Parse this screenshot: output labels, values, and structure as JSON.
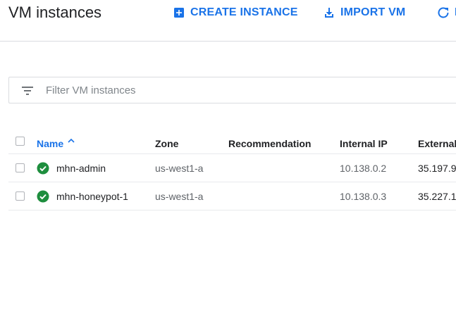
{
  "header": {
    "title": "VM instances",
    "actions": {
      "create_label": "CREATE INSTANCE",
      "import_label": "IMPORT VM",
      "refresh_label": "R"
    }
  },
  "filter": {
    "placeholder": "Filter VM instances",
    "value": ""
  },
  "table": {
    "columns": {
      "name": "Name",
      "zone": "Zone",
      "recommendation": "Recommendation",
      "internal_ip": "Internal IP",
      "external_ip": "External"
    },
    "rows": [
      {
        "name": "mhn-admin",
        "zone": "us-west1-a",
        "recommendation": "",
        "internal_ip": "10.138.0.2",
        "external_ip": "35.197.9",
        "status": "running"
      },
      {
        "name": "mhn-honeypot-1",
        "zone": "us-west1-a",
        "recommendation": "",
        "internal_ip": "10.138.0.3",
        "external_ip": "35.227.1",
        "status": "running"
      }
    ]
  },
  "icons": {
    "create": "add-box-icon",
    "import": "download-icon",
    "refresh": "refresh-icon",
    "filter": "filter-list-icon",
    "sort": "arrow-up-icon",
    "status_running": "check-circle-icon"
  },
  "colors": {
    "accent": "#1a73e8",
    "status_ok": "#1e8e3e",
    "text_primary": "#202124",
    "text_secondary": "#5f6368"
  }
}
